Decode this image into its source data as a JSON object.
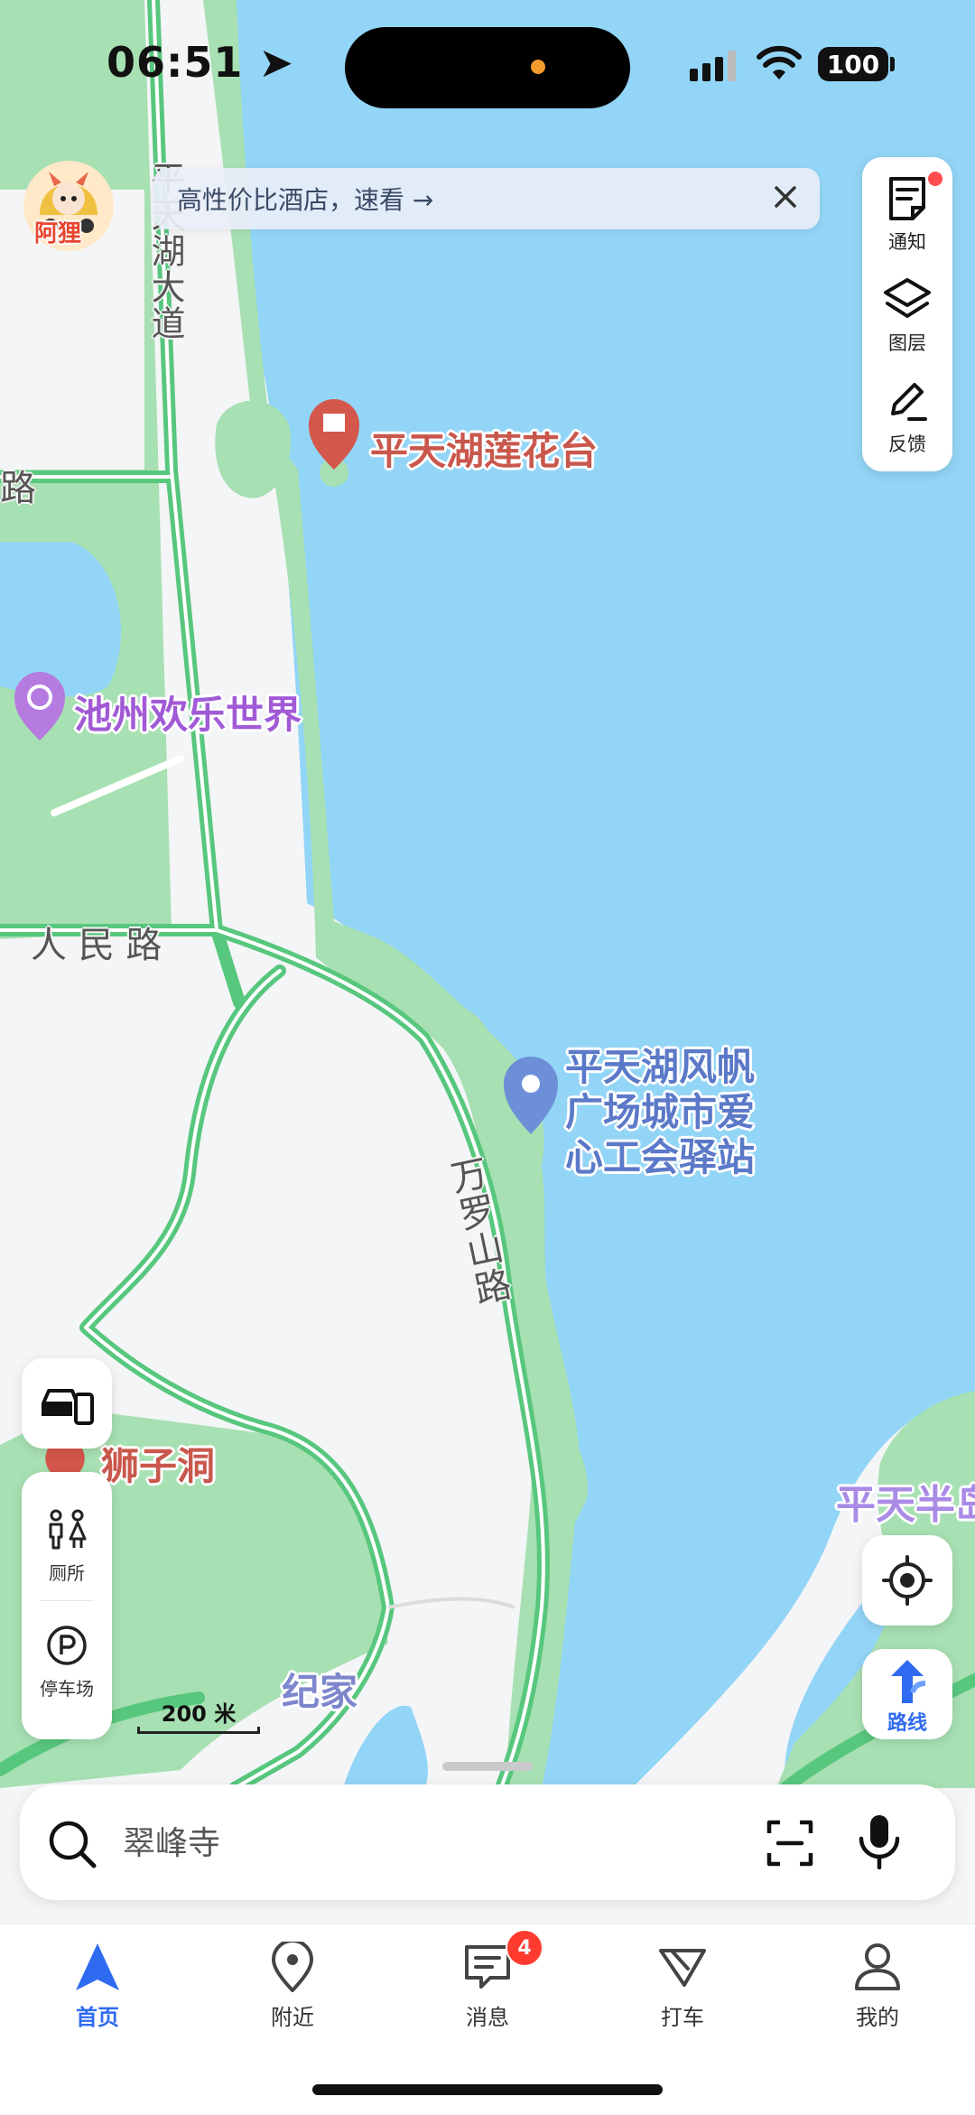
{
  "status_bar": {
    "time": "06:51",
    "battery": "100"
  },
  "banner": {
    "text": "高性价比酒店，速看 →"
  },
  "avatar": {
    "label": "阿狸"
  },
  "toolbar": {
    "items": [
      {
        "label": "通知",
        "icon": "notification-icon"
      },
      {
        "label": "图层",
        "icon": "layers-icon"
      },
      {
        "label": "反馈",
        "icon": "feedback-icon"
      }
    ]
  },
  "map": {
    "roads": {
      "pingtianhu_dadao": "平天湖大道",
      "renmin_lu": "人 民 路",
      "wanluoshan_lu": "万罗山路",
      "left_lu": "路"
    },
    "pois": {
      "lotus": "平天湖莲花台",
      "happy_world": "池州欢乐世界",
      "station_line1": "平天湖风帆",
      "station_line2": "广场城市爱",
      "station_line3": "心工会驿站",
      "lion_cave": "狮子洞",
      "peninsula": "平天半岛",
      "jijia": "纪家"
    },
    "scale": "200 米"
  },
  "facilities": {
    "items": [
      {
        "label": "厕所",
        "icon": "toilet-icon"
      },
      {
        "label": "停车场",
        "icon": "parking-icon"
      }
    ]
  },
  "route_button": {
    "label": "路线"
  },
  "search": {
    "placeholder": "翠峰寺"
  },
  "tabbar": {
    "items": [
      {
        "label": "首页",
        "icon": "navigation-arrow-icon",
        "active": true
      },
      {
        "label": "附近",
        "icon": "location-pin-icon"
      },
      {
        "label": "消息",
        "icon": "message-icon",
        "badge": "4"
      },
      {
        "label": "打车",
        "icon": "taxi-icon"
      },
      {
        "label": "我的",
        "icon": "user-icon"
      }
    ]
  },
  "colors": {
    "accent": "#2f6bf0",
    "water": "#93d5f6",
    "green": "#a7e0b2",
    "badge": "#ff3b30"
  }
}
